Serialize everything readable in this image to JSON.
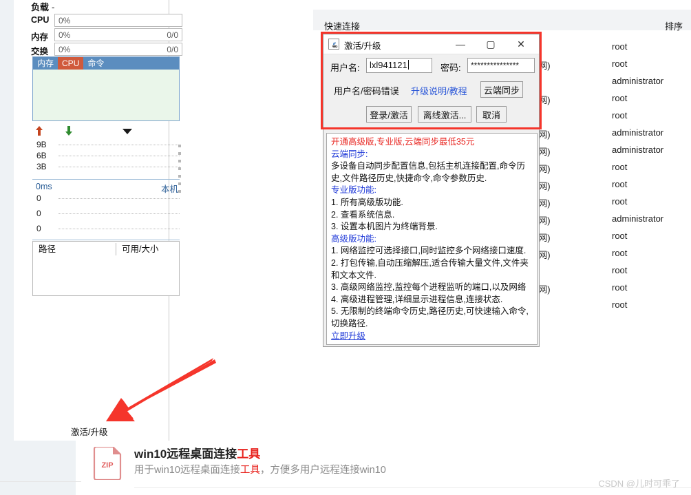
{
  "left_panel": {
    "load_label": "负载",
    "load_value": "-",
    "meters": [
      {
        "label": "CPU",
        "value": "0%",
        "ratio": ""
      },
      {
        "label": "内存",
        "value": "0%",
        "ratio": "0/0"
      },
      {
        "label": "交换",
        "value": "0%",
        "ratio": "0/0"
      }
    ],
    "process_table": {
      "columns": [
        "内存",
        "CPU",
        "命令"
      ]
    },
    "net_graph": {
      "upload_icon": "arrow-up-icon",
      "download_icon": "arrow-down-icon",
      "dropdown_icon": "chevron-down-icon",
      "yticks": [
        "9B",
        "6B",
        "3B"
      ]
    },
    "latency_graph": {
      "unit": "0ms",
      "host": "本机",
      "yticks": [
        "0",
        "0",
        "0"
      ]
    },
    "path_table": {
      "columns": [
        "路径",
        "可用/大小"
      ]
    },
    "activate_link": "激活/升级"
  },
  "quick_connect": {
    "title": "快速连接",
    "sort_label": "排序",
    "rows": [
      {
        "suffix": "",
        "user": "root"
      },
      {
        "suffix": "g网)",
        "user": "root"
      },
      {
        "suffix": "",
        "user": "administrator"
      },
      {
        "suffix": "g网)",
        "user": "root"
      },
      {
        "suffix": "",
        "user": "root"
      },
      {
        "suffix": "g网)",
        "user": "administrator"
      },
      {
        "suffix": "g网)",
        "user": "administrator"
      },
      {
        "suffix": "g网)",
        "user": "root"
      },
      {
        "suffix": "g网)",
        "user": "root"
      },
      {
        "suffix": "g网)",
        "user": "root"
      },
      {
        "suffix": "g网)",
        "user": "administrator"
      },
      {
        "suffix": "g网)",
        "user": "root"
      },
      {
        "suffix": "g网)",
        "user": "root"
      },
      {
        "suffix": "",
        "user": "root"
      },
      {
        "suffix": "g网)",
        "user": "root"
      },
      {
        "suffix": "",
        "user": "root"
      }
    ]
  },
  "dialog": {
    "icon": "java-cup-icon",
    "title": "激活/升级",
    "minimize": "—",
    "maximize": "▢",
    "close": "✕",
    "username_label": "用户名:",
    "username_value": "lxl941121",
    "password_label": "密码:",
    "password_value": "***************",
    "error_text": "用户名/密码错误",
    "help_link": "升级说明/教程",
    "cloud_sync_button": "云端同步",
    "login_button": "登录/激活",
    "offline_button": "离线激活...",
    "cancel_button": "取消",
    "info": {
      "promo": "开通高级版,专业版,云端同步最低35元",
      "sections": [
        {
          "heading": "云端同步:",
          "lines": [
            "多设备自动同步配置信息,包括主机连接配置,命令历",
            "史,文件路径历史,快捷命令,命令参数历史."
          ]
        },
        {
          "heading": "专业版功能:",
          "lines": [
            "1. 所有高级版功能.",
            "2. 查看系统信息.",
            "3. 设置本机图片为终端背景."
          ]
        },
        {
          "heading": "高级版功能:",
          "lines": [
            "1. 网络监控可选择接口,同时监控多个网络接口速度.",
            "2. 打包传输,自动压缩解压,适合传输大量文件,文件夹",
            "和文本文件.",
            "3. 高级网络监控,监控每个进程监听的端口,以及网络",
            "4. 高级进程管理,详细显示进程信息,连接状态.",
            "5. 无限制的终端命令历史,路径历史,可快速输入命令,",
            "切换路径."
          ]
        }
      ],
      "upgrade_link": "立即升级"
    }
  },
  "attachment": {
    "badge": "ZIP",
    "title_plain": "win10远程桌面连接",
    "title_highlight": "工具",
    "desc_prefix": "用于win10远程桌面连接",
    "desc_highlight": "工具",
    "desc_suffix": "，方便多用户远程连接win10"
  },
  "watermark": "CSDN @儿时可乖了",
  "colors": {
    "accent_blue": "#5b8dbf",
    "cpu_orange": "#d05a3c",
    "annotation_red": "#f5352b",
    "link_blue": "#1f39d8",
    "promo_red": "#e8241f"
  }
}
